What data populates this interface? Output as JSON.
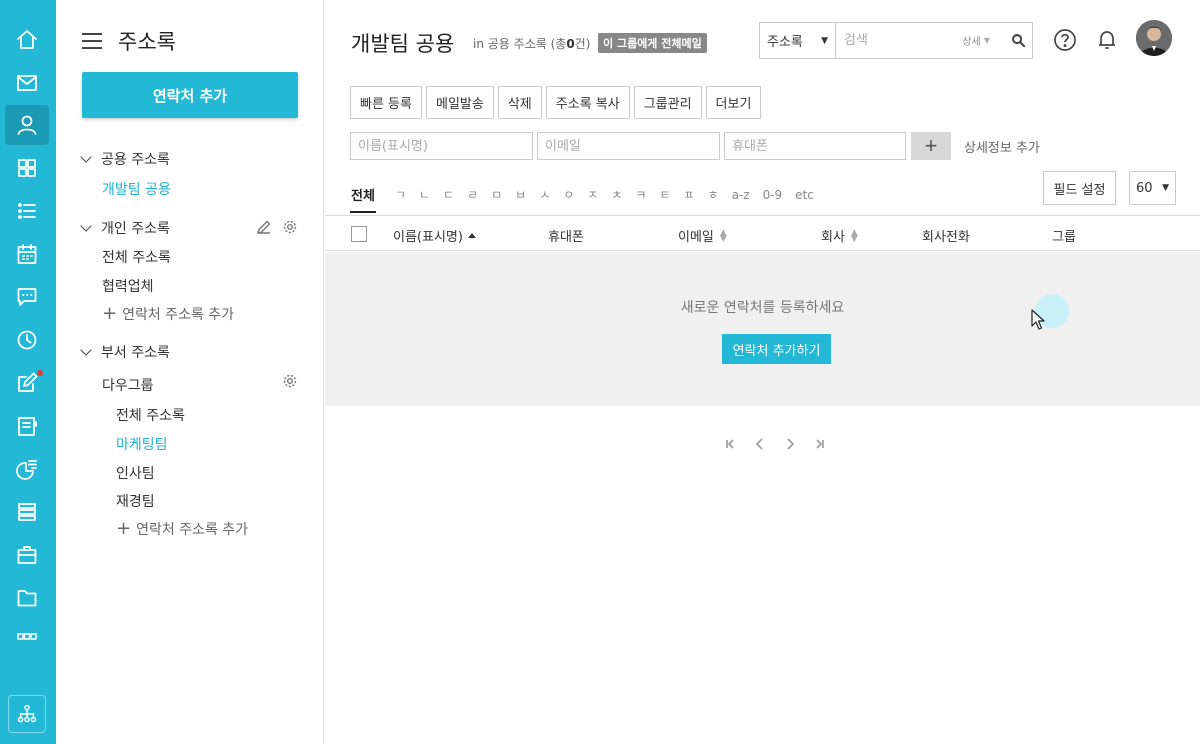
{
  "rail": {
    "items": [
      {
        "icon": "home-icon"
      },
      {
        "icon": "mail-icon"
      },
      {
        "icon": "person-icon",
        "active": true
      },
      {
        "icon": "grid-icon"
      },
      {
        "icon": "list-icon"
      },
      {
        "icon": "calendar-icon"
      },
      {
        "icon": "chat-icon"
      },
      {
        "icon": "clock-icon"
      },
      {
        "icon": "edit-icon",
        "badge": true
      },
      {
        "icon": "board-icon"
      },
      {
        "icon": "report-icon"
      },
      {
        "icon": "stack-icon"
      },
      {
        "icon": "briefcase-icon"
      },
      {
        "icon": "folder-icon"
      },
      {
        "icon": "group-icon"
      }
    ],
    "bottom_icon": "org-chart-icon"
  },
  "nav": {
    "title": "주소록",
    "add_button": "연락처 추가",
    "public_section": "공용 주소록",
    "public_items": [
      "개발팀 공용"
    ],
    "personal_section": "개인 주소록",
    "personal_items": [
      "전체 주소록",
      "협력업체"
    ],
    "personal_add": "연락처 주소록 추가",
    "dept_section": "부서 주소록",
    "dept_group": "다우그룹",
    "dept_items": [
      "전체 주소록",
      "마케팅팀",
      "인사팀",
      "재경팀"
    ],
    "dept_add": "연락처 주소록 추가"
  },
  "header": {
    "title": "개발팀 공용",
    "subtitle_prefix": "in 공용 주소록 (총",
    "subtitle_count": "0",
    "subtitle_suffix": "건)",
    "mail_badge": "이 그룹에게 전체메일",
    "search_scope": "주소록",
    "search_placeholder": "검색",
    "search_detail": "상세"
  },
  "toolbar": {
    "buttons": [
      "빠른 등록",
      "메일발송",
      "삭제",
      "주소록 복사",
      "그룹관리",
      "더보기"
    ]
  },
  "quick_add": {
    "name_placeholder": "이름(표시명)",
    "email_placeholder": "이메일",
    "phone_placeholder": "휴대폰",
    "plus": "+",
    "detail_link": "상세정보 추가"
  },
  "index": {
    "tabs": [
      "전체",
      "ㄱ",
      "ㄴ",
      "ㄷ",
      "ㄹ",
      "ㅁ",
      "ㅂ",
      "ㅅ",
      "ㅇ",
      "ㅈ",
      "ㅊ",
      "ㅋ",
      "ㅌ",
      "ㅍ",
      "ㅎ",
      "a-z",
      "0-9",
      "etc"
    ],
    "field_settings": "필드 설정",
    "page_size": "60"
  },
  "table": {
    "columns": [
      "이름(표시명)",
      "휴대폰",
      "이메일",
      "회사",
      "회사전화",
      "그룹"
    ]
  },
  "empty": {
    "message": "새로운 연락처를 등록하세요",
    "button": "연락처 추가하기"
  }
}
